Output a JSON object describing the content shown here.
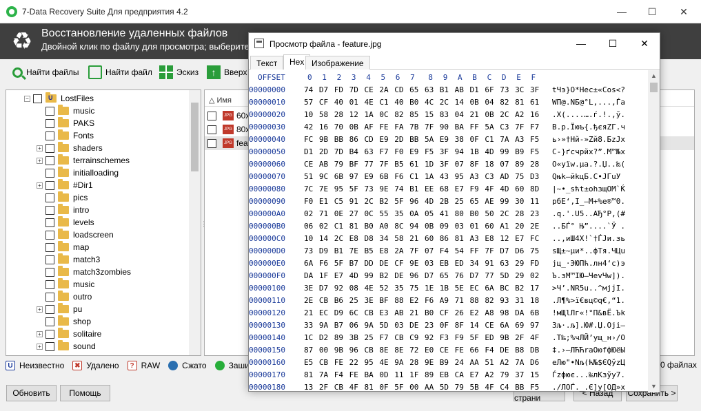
{
  "window": {
    "title": "7-Data Recovery Suite Для предприятия 4.2",
    "minimize": "—",
    "maximize": "☐",
    "close": "✕"
  },
  "header": {
    "title": "Восстановление удаленных файлов",
    "subtitle": "Двойной клик по файлу для просмотра; выберите"
  },
  "toolbar": {
    "find_files": "Найти файлы",
    "find_file": "Найти файл",
    "thumbnail": "Эскиз",
    "up": "Вверх"
  },
  "tree": {
    "root": "LostFiles",
    "items": [
      "music",
      "PAKS",
      "Fonts",
      "shaders",
      "terrainschemes",
      "initialloading",
      "#Dir1",
      "pics",
      "intro",
      "levels",
      "loadscreen",
      "map",
      "match3",
      "match3zombies",
      "music",
      "outro",
      "pu",
      "shop",
      "solitaire",
      "sound"
    ],
    "expandable": [
      false,
      false,
      false,
      true,
      true,
      false,
      true,
      false,
      false,
      false,
      false,
      false,
      false,
      false,
      false,
      false,
      true,
      false,
      true,
      true
    ]
  },
  "list": {
    "column_name": "Имя",
    "rows": [
      "60x4",
      "80x8",
      "featu"
    ]
  },
  "status": {
    "unknown": "Неизвестно",
    "deleted": "Удалено",
    "raw": "RAW",
    "compressed": "Сжато",
    "encrypted": "Зашифр",
    "files_count": "0 файлах"
  },
  "bottom": {
    "refresh": "Обновить",
    "help": "Помощь",
    "prev_page": "звная страни",
    "back": "< Назад",
    "save": "Сохранить >"
  },
  "viewer": {
    "title": "Просмотр файла - feature.jpg",
    "minimize": "—",
    "maximize": "☐",
    "close": "✕",
    "tabs": [
      "Текст",
      "Hex",
      "Изображение"
    ],
    "offset_label": "OFFSET",
    "columns": [
      "0",
      "1",
      "2",
      "3",
      "4",
      "5",
      "6",
      "7",
      "8",
      "9",
      "A",
      "B",
      "C",
      "D",
      "E",
      "F"
    ],
    "rows": [
      {
        "addr": "00000000",
        "bytes": "74 D7 FD 7D CE 2A CD 65 63 B1 AB D1 6F 73 3C 3F",
        "text": "tЧэ}О*Нес±«Сos<?"
      },
      {
        "addr": "00000010",
        "bytes": "57 CF 40 01 4E C1 40 B0 4C 2C 14 0B 04 82 81 61",
        "text": "WП@.NБ@°L,...‚Ѓa"
      },
      {
        "addr": "00000020",
        "bytes": "10 58 28 12 1A 0C 82 85 15 83 04 21 0B 2C A2 16",
        "text": ".X(....….ѓ.!.,ў."
      },
      {
        "addr": "00000030",
        "bytes": "42 16 70 0B AF FE FA 7B 7F 90 BA FF 5A C3 7F F7",
        "text": "B.p.Їюъ{.ђєяZГ.ч"
      },
      {
        "addr": "00000040",
        "bytes": "FC 9B BB 86 CD E9 2D BB 5A E9 38 0F C1 7A A3 F5",
        "text": "ь›»†Нй-»Zй8.БzЈх"
      },
      {
        "addr": "00000050",
        "bytes": "D1 2D 7D B4 63 F7 F0 E9 F5 3F 94 1B 4D 99 B9 F5",
        "text": "С-}ґcчрйх?”.M™№х"
      },
      {
        "addr": "00000060",
        "bytes": "CE AB 79 BF 77 7F B5 61 1D 3F 07 8F 18 07 89 28",
        "text": "О«yїw.µa.?.Џ..‰("
      },
      {
        "addr": "00000070",
        "bytes": "51 9C 6B 97 E9 6B F6 C1 1A 43 95 A3 C3 AD 75 D3",
        "text": "Qњk—йkцБ.C•ЈГ­uУ"
      },
      {
        "addr": "00000080",
        "bytes": "7C 7E 95 5F 73 9E 74 B1 EE 68 E7 F9 4F 4D 60 8D",
        "text": "|~•_sћt±оhзщOM`Ќ"
      },
      {
        "addr": "00000090",
        "bytes": "F0 E1 C5 91 2C B2 5F 96 4D 2B 25 65 AE 99 30 11",
        "text": "рбЕ‘,І_–M+%e®™0."
      },
      {
        "addr": "000000A0",
        "bytes": "02 71 0E 27 0C 55 35 0A 05 41 80 B0 50 2C 28 23",
        "text": ".q.'.U5..AЂ°P,(#"
      },
      {
        "addr": "000000B0",
        "bytes": "06 02 C1 81 B0 A0 8C 94 0B 09 03 01 60 A1 20 2E",
        "text": "..БЃ° Њ”....`Ў ."
      },
      {
        "addr": "000000C0",
        "bytes": "10 14 2C E8 D8 34 58 21 60 86 81 A3 E8 12 E7 FC",
        "text": "..,иШ4X!`†ЃЈи.зь"
      },
      {
        "addr": "000000D0",
        "bytes": "73 D9 B1 7E B5 E8 2A 7F 07 F4 54 FF 7F D7 D6 75",
        "text": "sЩ±~µи*..фTя.ЧЦu"
      },
      {
        "addr": "000000E0",
        "bytes": "6A F6 5F B7 DD DE CF 9E 03 EB ED 34 91 63 29 FD",
        "text": "jц_·ЭЮПћ.лн4‘c)э"
      },
      {
        "addr": "000000F0",
        "bytes": "DA 1F E7 4D 99 B2 DE 96 D7 65 76 D7 77 5D 29 02",
        "text": "Ъ.зM™ІЮ–ЧevЧw])."
      },
      {
        "addr": "00000100",
        "bytes": "3E D7 92 08 4E 52 35 75 1E 1B 5E EC 6A BC B2 17",
        "text": ">Ч’.NR5u..^мjјІ."
      },
      {
        "addr": "00000110",
        "bytes": "2E CB B6 25 3E BF 88 E2 F6 A9 71 88 82 93 31 18",
        "text": ".Л¶%>ї€вц©q€‚“1."
      },
      {
        "addr": "00000120",
        "bytes": "21 EC D9 6C CB E3 AB 21 B0 CF 26 E2 A8 98 DA 6B",
        "text": "!мЩlЛг«!°П&вЁ.Ъk"
      },
      {
        "addr": "00000130",
        "bytes": "33 9A B7 06 9A 5D 03 DE 23 0F 8F 14 CE 6A 69 97",
        "text": "3љ·.љ].Ю#.Џ.Оji—"
      },
      {
        "addr": "00000140",
        "bytes": "1C D2 89 3B 25 F7 CB C9 92 F3 F9 5F ED 9B 2F 4F",
        "text": ".Т‰;%чЛЙ’ущ_н›/O"
      },
      {
        "addr": "00000150",
        "bytes": "87 00 9B 96 CB 8E 8E 72 E0 CE FE 66 F4 DE B8 DB",
        "text": "‡.›–ЛЋЋrаОюfфЮёЫ"
      },
      {
        "addr": "00000160",
        "bytes": "E5 CB FE 22 95 4E 9A 28 9E B9 24 AA 51 A2 7A D6",
        "text": "еЛю\"•Nљ(ћ№$ЄQўzЦ"
      },
      {
        "addr": "00000170",
        "bytes": "81 7A F4 FE BA 0D 11 1F 89 EB CA E7 A2 79 37 15",
        "text": "Ѓzфює...‰лКзўy7."
      },
      {
        "addr": "00000180",
        "bytes": "13 2F CB 4F 81 0F 5F 00 AA 5D 79 5B 4F C4 BB F5",
        "text": "./ЛOЃ._.Є]y[OД»х"
      }
    ]
  }
}
